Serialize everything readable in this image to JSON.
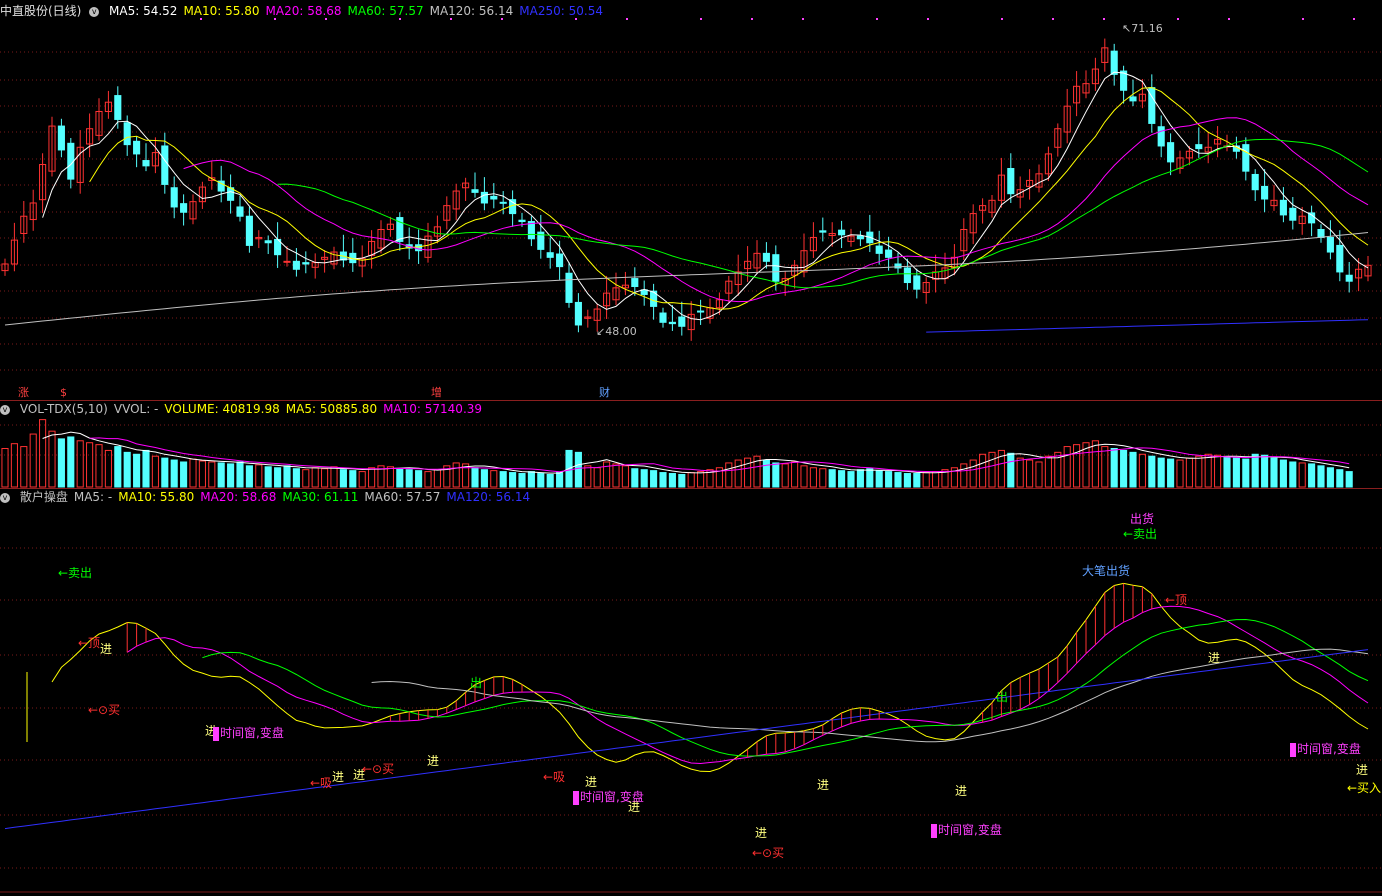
{
  "main_panel": {
    "title": "中直股份(日线)",
    "ma_labels": [
      {
        "text": "MA5: 54.52",
        "color": "#ffffff"
      },
      {
        "text": "MA10: 55.80",
        "color": "#ffff00"
      },
      {
        "text": "MA20: 58.68",
        "color": "#ff00ff"
      },
      {
        "text": "MA60: 57.57",
        "color": "#00ff00"
      },
      {
        "text": "MA120: 56.14",
        "color": "#c0c0c0"
      },
      {
        "text": "MA250: 50.54",
        "color": "#3030ff"
      }
    ],
    "price_high": "71.16",
    "price_low": "48.00",
    "event_markers": [
      {
        "text": "涨",
        "color": "#ff4040"
      },
      {
        "text": "$",
        "color": "#ff4040"
      },
      {
        "text": "增",
        "color": "#ff4040"
      },
      {
        "text": "财",
        "color": "#60a0ff"
      }
    ]
  },
  "volume_panel": {
    "labels": [
      {
        "text": "VOL-TDX(5,10)",
        "color": "#c0c0c0"
      },
      {
        "text": "VVOL: -",
        "color": "#c0c0c0"
      },
      {
        "text": "VOLUME: 40819.98",
        "color": "#ffff00"
      },
      {
        "text": "MA5: 50885.80",
        "color": "#ffff00"
      },
      {
        "text": "MA10: 57140.39",
        "color": "#ff00ff"
      }
    ]
  },
  "indicator_panel": {
    "labels": [
      {
        "text": "散户操盘",
        "color": "#c0c0c0"
      },
      {
        "text": "MA5: -",
        "color": "#c0c0c0"
      },
      {
        "text": "MA10: 55.80",
        "color": "#ffff00"
      },
      {
        "text": "MA20: 58.68",
        "color": "#ff00ff"
      },
      {
        "text": "MA30: 61.11",
        "color": "#00ff00"
      },
      {
        "text": "MA60: 57.57",
        "color": "#c0c0c0"
      },
      {
        "text": "MA120: 56.14",
        "color": "#3030ff"
      }
    ],
    "annotations": [
      {
        "text": "←卖出",
        "color": "#00ff00"
      },
      {
        "text": "←顶",
        "color": "#ff3030"
      },
      {
        "text": "进",
        "color": "#ffff80"
      },
      {
        "text": "←⊙买",
        "color": "#ff3030"
      },
      {
        "text": "进",
        "color": "#ffff80"
      },
      {
        "text": "时间窗,变盘",
        "color": "#ff40ff"
      },
      {
        "text": "←吸",
        "color": "#ff3030"
      },
      {
        "text": "进",
        "color": "#ffff80"
      },
      {
        "text": "进",
        "color": "#ffff80"
      },
      {
        "text": "←⊙买",
        "color": "#ff3030"
      },
      {
        "text": "进",
        "color": "#ffff80"
      },
      {
        "text": "出",
        "color": "#00ff00"
      },
      {
        "text": "←吸",
        "color": "#ff3030"
      },
      {
        "text": "进",
        "color": "#ffff80"
      },
      {
        "text": "时间窗,变盘",
        "color": "#ff40ff"
      },
      {
        "text": "进",
        "color": "#ffff80"
      },
      {
        "text": "进",
        "color": "#ffff80"
      },
      {
        "text": "←⊙买",
        "color": "#ff3030"
      },
      {
        "text": "进",
        "color": "#ffff80"
      },
      {
        "text": "时间窗,变盘",
        "color": "#ff40ff"
      },
      {
        "text": "进",
        "color": "#ffff80"
      },
      {
        "text": "出",
        "color": "#00ff00"
      },
      {
        "text": "大笔出货",
        "color": "#60a0ff"
      },
      {
        "text": "出货",
        "color": "#ff40ff"
      },
      {
        "text": "←卖出",
        "color": "#00ff00"
      },
      {
        "text": "←顶",
        "color": "#ff3030"
      },
      {
        "text": "进",
        "color": "#ffff80"
      },
      {
        "text": "时间窗,变盘",
        "color": "#ff40ff"
      },
      {
        "text": "进",
        "color": "#ffff80"
      },
      {
        "text": "←买入",
        "color": "#ffff00"
      }
    ]
  },
  "colors": {
    "up": "#ff3232",
    "down": "#54ffff",
    "grid": "#7a1a1a",
    "ma5": "#ffffff",
    "ma10": "#ffff00",
    "ma20": "#ff00ff",
    "ma60": "#00ff00",
    "ma120": "#c0c0c0",
    "ma250": "#3030ff"
  },
  "chart_data": {
    "type": "candlestick",
    "ylim": [
      46,
      73
    ],
    "close": [
      54.6,
      56.4,
      58.2,
      59.2,
      62.1,
      65.0,
      63.2,
      61.0,
      63.4,
      64.8,
      66.1,
      66.8,
      65.5,
      63.6,
      62.9,
      62.0,
      63.0,
      60.6,
      58.9,
      58.5,
      59.3,
      60.4,
      61.1,
      60.1,
      59.4,
      58.2,
      56.0,
      56.6,
      56.2,
      55.3,
      54.8,
      54.2,
      54.6,
      54.7,
      55.1,
      55.5,
      54.9,
      54.7,
      55.0,
      56.3,
      57.2,
      57.6,
      56.3,
      55.8,
      55.6,
      56.7,
      57.4,
      59.0,
      60.1,
      60.7,
      60.0,
      59.2,
      59.5,
      59.2,
      58.4,
      57.8,
      56.5,
      55.7,
      55.1,
      54.4,
      51.7,
      50.0,
      50.6,
      51.2,
      52.4,
      52.8,
      53.0,
      52.9,
      52.3,
      51.4,
      50.2,
      50.1,
      49.9,
      50.8,
      51.0,
      51.3,
      51.9,
      53.3,
      54.0,
      54.8,
      55.4,
      54.8,
      53.3,
      53.5,
      54.5,
      55.6,
      56.6,
      57.0,
      56.9,
      56.8,
      56.7,
      56.5,
      56.2,
      55.4,
      55.1,
      54.3,
      53.2,
      52.7,
      53.2,
      54.0,
      54.3,
      55.1,
      57.2,
      58.4,
      59.0,
      59.4,
      61.3,
      59.9,
      60.2,
      60.9,
      61.4,
      62.9,
      64.8,
      66.5,
      68.0,
      68.2,
      69.3,
      70.9,
      68.9,
      67.7,
      66.9,
      67.4,
      65.2,
      63.5,
      62.3,
      62.6,
      63.1,
      63.3,
      63.4,
      64.0,
      63.5,
      63.1,
      61.6,
      60.2,
      59.5,
      59.4,
      58.3,
      57.9,
      58.2,
      57.7,
      56.6,
      55.5,
      54.0,
      53.3,
      54.2,
      54.5
    ],
    "volume": [
      40,
      45,
      42,
      55,
      70,
      58,
      50,
      52,
      48,
      46,
      44,
      38,
      42,
      36,
      34,
      38,
      32,
      30,
      28,
      26,
      29,
      27,
      26,
      25,
      24,
      26,
      22,
      23,
      21,
      20,
      22,
      19,
      18,
      20,
      19,
      21,
      18,
      17,
      16,
      20,
      22,
      21,
      19,
      18,
      17,
      16,
      18,
      22,
      25,
      24,
      20,
      18,
      17,
      16,
      15,
      14,
      16,
      14,
      13,
      15,
      38,
      36,
      22,
      20,
      26,
      24,
      22,
      19,
      18,
      17,
      15,
      14,
      13,
      15,
      16,
      18,
      20,
      25,
      28,
      30,
      32,
      28,
      25,
      24,
      26,
      22,
      20,
      19,
      18,
      17,
      16,
      18,
      19,
      17,
      16,
      15,
      14,
      14,
      15,
      16,
      18,
      20,
      24,
      28,
      34,
      36,
      38,
      35,
      30,
      28,
      26,
      32,
      36,
      42,
      44,
      46,
      48,
      42,
      40,
      38,
      36,
      34,
      32,
      30,
      29,
      28,
      30,
      32,
      34,
      33,
      31,
      30,
      29,
      34,
      33,
      30,
      28,
      26,
      25,
      24,
      22,
      20,
      18,
      16
    ],
    "vol_ylim": [
      0,
      80
    ],
    "series": [
      {
        "name": "MA5",
        "values": []
      },
      {
        "name": "MA10",
        "values": []
      },
      {
        "name": "MA20",
        "values": []
      },
      {
        "name": "MA60",
        "values": []
      },
      {
        "name": "MA120",
        "values": []
      },
      {
        "name": "MA250",
        "values": []
      }
    ]
  }
}
